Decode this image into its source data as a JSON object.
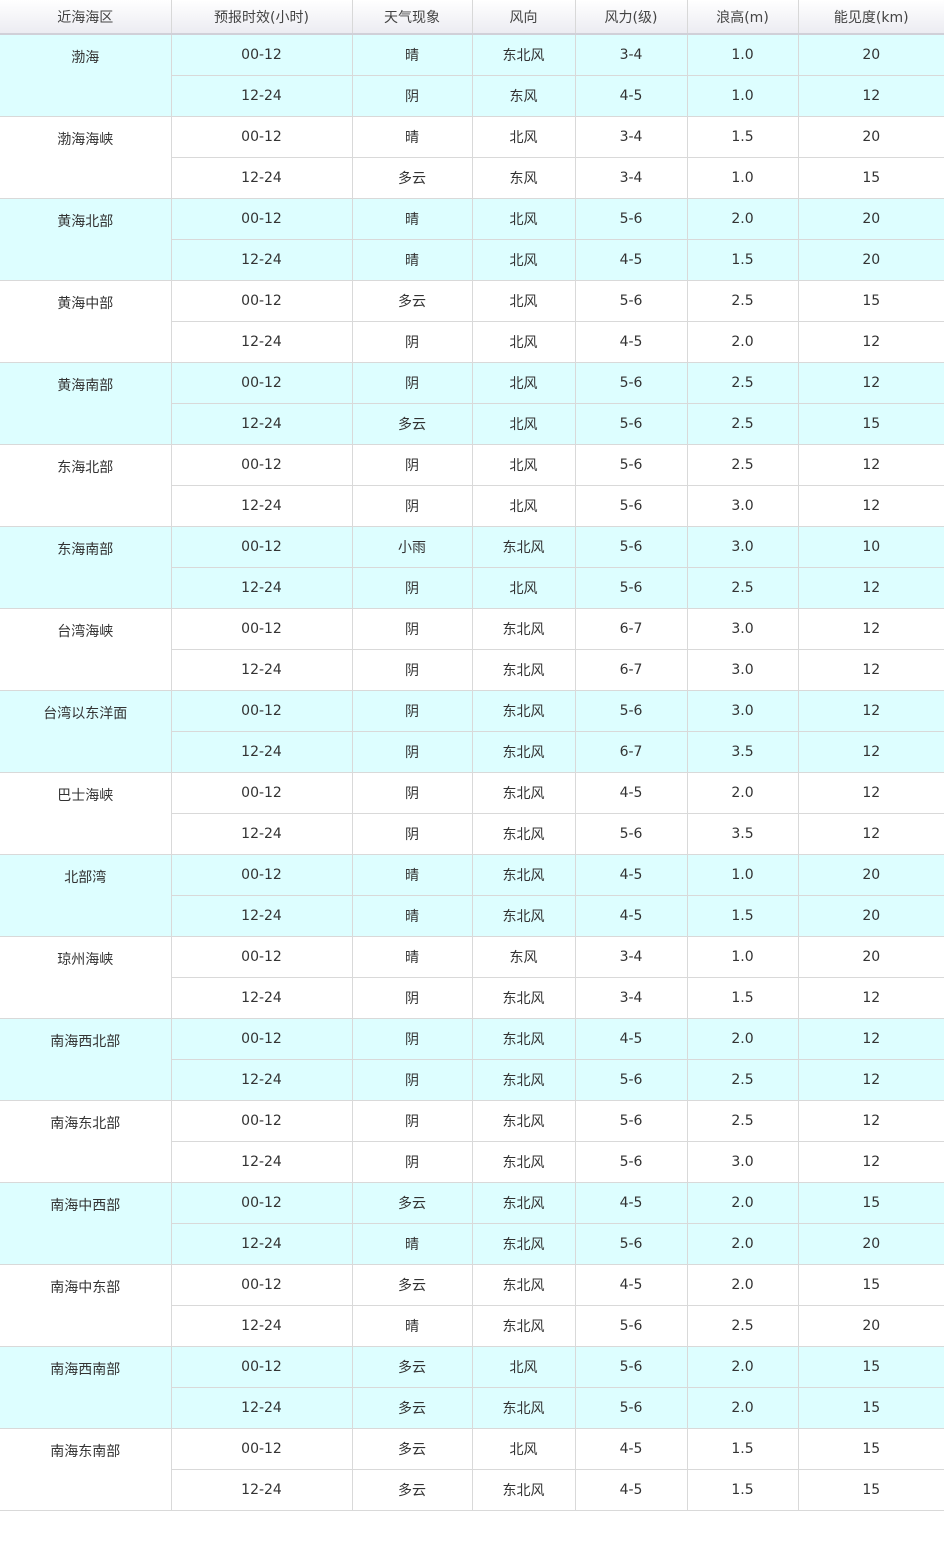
{
  "header": {
    "area": "近海海区",
    "period": "预报时效(小时)",
    "weather": "天气现象",
    "wind_dir": "风向",
    "wind_force": "风力(级)",
    "wave": "浪高(m)",
    "visibility": "能见度(km)"
  },
  "rows": [
    {
      "area": "渤海",
      "a": {
        "period": "00-12",
        "weather": "晴",
        "wind_dir": "东北风",
        "wind_force": "3-4",
        "wave": "1.0",
        "visibility": "20"
      },
      "b": {
        "period": "12-24",
        "weather": "阴",
        "wind_dir": "东风",
        "wind_force": "4-5",
        "wave": "1.0",
        "visibility": "12"
      }
    },
    {
      "area": "渤海海峡",
      "a": {
        "period": "00-12",
        "weather": "晴",
        "wind_dir": "北风",
        "wind_force": "3-4",
        "wave": "1.5",
        "visibility": "20"
      },
      "b": {
        "period": "12-24",
        "weather": "多云",
        "wind_dir": "东风",
        "wind_force": "3-4",
        "wave": "1.0",
        "visibility": "15"
      }
    },
    {
      "area": "黄海北部",
      "a": {
        "period": "00-12",
        "weather": "晴",
        "wind_dir": "北风",
        "wind_force": "5-6",
        "wave": "2.0",
        "visibility": "20"
      },
      "b": {
        "period": "12-24",
        "weather": "晴",
        "wind_dir": "北风",
        "wind_force": "4-5",
        "wave": "1.5",
        "visibility": "20"
      }
    },
    {
      "area": "黄海中部",
      "a": {
        "period": "00-12",
        "weather": "多云",
        "wind_dir": "北风",
        "wind_force": "5-6",
        "wave": "2.5",
        "visibility": "15"
      },
      "b": {
        "period": "12-24",
        "weather": "阴",
        "wind_dir": "北风",
        "wind_force": "4-5",
        "wave": "2.0",
        "visibility": "12"
      }
    },
    {
      "area": "黄海南部",
      "a": {
        "period": "00-12",
        "weather": "阴",
        "wind_dir": "北风",
        "wind_force": "5-6",
        "wave": "2.5",
        "visibility": "12"
      },
      "b": {
        "period": "12-24",
        "weather": "多云",
        "wind_dir": "北风",
        "wind_force": "5-6",
        "wave": "2.5",
        "visibility": "15"
      }
    },
    {
      "area": "东海北部",
      "a": {
        "period": "00-12",
        "weather": "阴",
        "wind_dir": "北风",
        "wind_force": "5-6",
        "wave": "2.5",
        "visibility": "12"
      },
      "b": {
        "period": "12-24",
        "weather": "阴",
        "wind_dir": "北风",
        "wind_force": "5-6",
        "wave": "3.0",
        "visibility": "12"
      }
    },
    {
      "area": "东海南部",
      "a": {
        "period": "00-12",
        "weather": "小雨",
        "wind_dir": "东北风",
        "wind_force": "5-6",
        "wave": "3.0",
        "visibility": "10"
      },
      "b": {
        "period": "12-24",
        "weather": "阴",
        "wind_dir": "北风",
        "wind_force": "5-6",
        "wave": "2.5",
        "visibility": "12"
      }
    },
    {
      "area": "台湾海峡",
      "a": {
        "period": "00-12",
        "weather": "阴",
        "wind_dir": "东北风",
        "wind_force": "6-7",
        "wave": "3.0",
        "visibility": "12"
      },
      "b": {
        "period": "12-24",
        "weather": "阴",
        "wind_dir": "东北风",
        "wind_force": "6-7",
        "wave": "3.0",
        "visibility": "12"
      }
    },
    {
      "area": "台湾以东洋面",
      "a": {
        "period": "00-12",
        "weather": "阴",
        "wind_dir": "东北风",
        "wind_force": "5-6",
        "wave": "3.0",
        "visibility": "12"
      },
      "b": {
        "period": "12-24",
        "weather": "阴",
        "wind_dir": "东北风",
        "wind_force": "6-7",
        "wave": "3.5",
        "visibility": "12"
      }
    },
    {
      "area": "巴士海峡",
      "a": {
        "period": "00-12",
        "weather": "阴",
        "wind_dir": "东北风",
        "wind_force": "4-5",
        "wave": "2.0",
        "visibility": "12"
      },
      "b": {
        "period": "12-24",
        "weather": "阴",
        "wind_dir": "东北风",
        "wind_force": "5-6",
        "wave": "3.5",
        "visibility": "12"
      }
    },
    {
      "area": "北部湾",
      "a": {
        "period": "00-12",
        "weather": "晴",
        "wind_dir": "东北风",
        "wind_force": "4-5",
        "wave": "1.0",
        "visibility": "20"
      },
      "b": {
        "period": "12-24",
        "weather": "晴",
        "wind_dir": "东北风",
        "wind_force": "4-5",
        "wave": "1.5",
        "visibility": "20"
      }
    },
    {
      "area": "琼州海峡",
      "a": {
        "period": "00-12",
        "weather": "晴",
        "wind_dir": "东风",
        "wind_force": "3-4",
        "wave": "1.0",
        "visibility": "20"
      },
      "b": {
        "period": "12-24",
        "weather": "阴",
        "wind_dir": "东北风",
        "wind_force": "3-4",
        "wave": "1.5",
        "visibility": "12"
      }
    },
    {
      "area": "南海西北部",
      "a": {
        "period": "00-12",
        "weather": "阴",
        "wind_dir": "东北风",
        "wind_force": "4-5",
        "wave": "2.0",
        "visibility": "12"
      },
      "b": {
        "period": "12-24",
        "weather": "阴",
        "wind_dir": "东北风",
        "wind_force": "5-6",
        "wave": "2.5",
        "visibility": "12"
      }
    },
    {
      "area": "南海东北部",
      "a": {
        "period": "00-12",
        "weather": "阴",
        "wind_dir": "东北风",
        "wind_force": "5-6",
        "wave": "2.5",
        "visibility": "12"
      },
      "b": {
        "period": "12-24",
        "weather": "阴",
        "wind_dir": "东北风",
        "wind_force": "5-6",
        "wave": "3.0",
        "visibility": "12"
      }
    },
    {
      "area": "南海中西部",
      "a": {
        "period": "00-12",
        "weather": "多云",
        "wind_dir": "东北风",
        "wind_force": "4-5",
        "wave": "2.0",
        "visibility": "15"
      },
      "b": {
        "period": "12-24",
        "weather": "晴",
        "wind_dir": "东北风",
        "wind_force": "5-6",
        "wave": "2.0",
        "visibility": "20"
      }
    },
    {
      "area": "南海中东部",
      "a": {
        "period": "00-12",
        "weather": "多云",
        "wind_dir": "东北风",
        "wind_force": "4-5",
        "wave": "2.0",
        "visibility": "15"
      },
      "b": {
        "period": "12-24",
        "weather": "晴",
        "wind_dir": "东北风",
        "wind_force": "5-6",
        "wave": "2.5",
        "visibility": "20"
      }
    },
    {
      "area": "南海西南部",
      "a": {
        "period": "00-12",
        "weather": "多云",
        "wind_dir": "北风",
        "wind_force": "5-6",
        "wave": "2.0",
        "visibility": "15"
      },
      "b": {
        "period": "12-24",
        "weather": "多云",
        "wind_dir": "东北风",
        "wind_force": "5-6",
        "wave": "2.0",
        "visibility": "15"
      }
    },
    {
      "area": "南海东南部",
      "a": {
        "period": "00-12",
        "weather": "多云",
        "wind_dir": "北风",
        "wind_force": "4-5",
        "wave": "1.5",
        "visibility": "15"
      },
      "b": {
        "period": "12-24",
        "weather": "多云",
        "wind_dir": "东北风",
        "wind_force": "4-5",
        "wave": "1.5",
        "visibility": "15"
      }
    }
  ]
}
